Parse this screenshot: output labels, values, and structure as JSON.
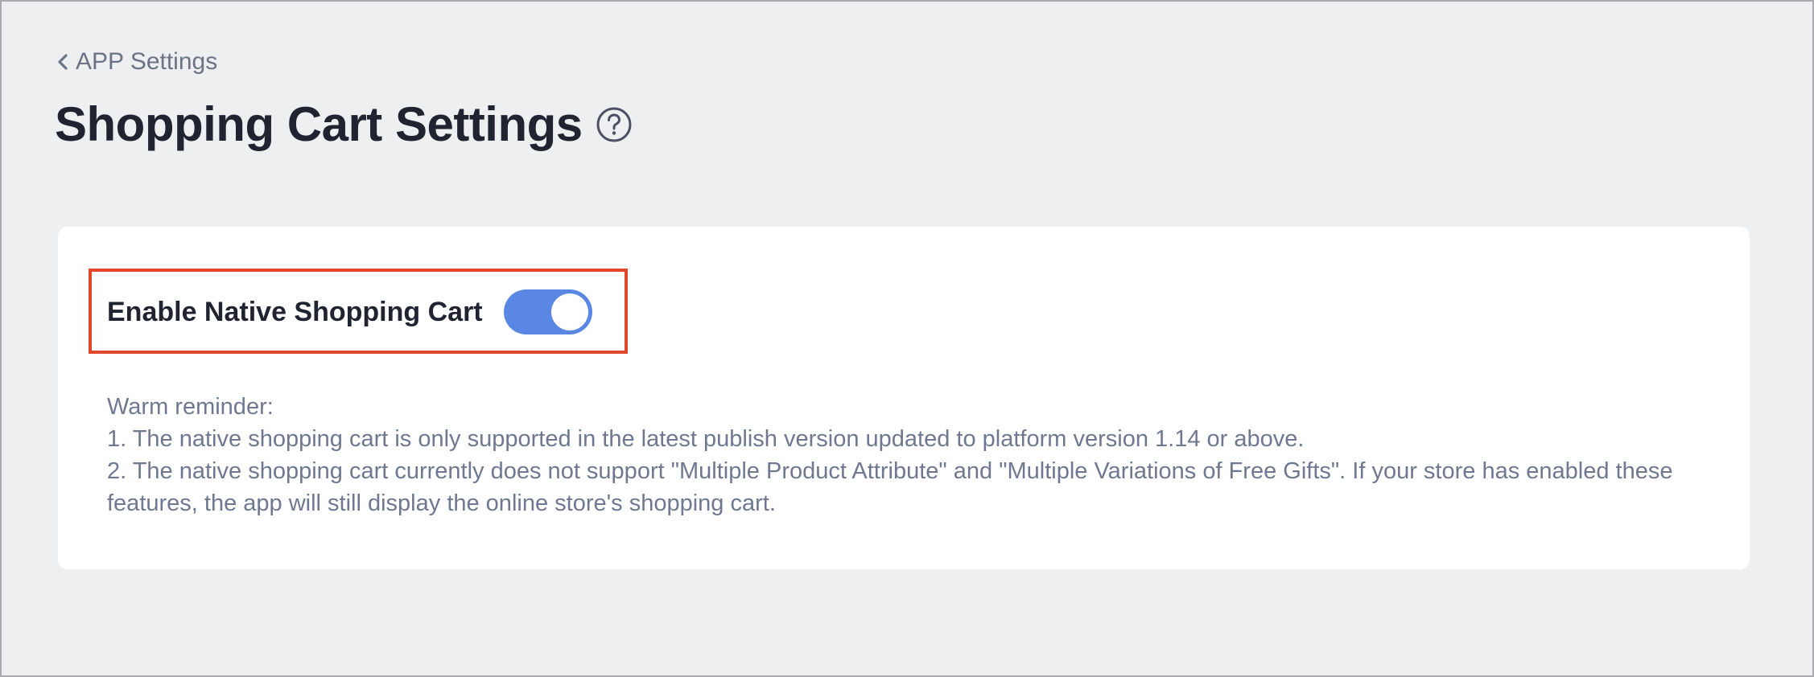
{
  "header": {
    "back_label": "APP Settings",
    "title": "Shopping Cart Settings",
    "help_icon": "question-circle-icon"
  },
  "settings": {
    "native_cart_toggle": {
      "label": "Enable Native Shopping Cart",
      "enabled": true
    },
    "reminder": {
      "heading": "Warm reminder:",
      "items": [
        "1. The native shopping cart is only supported in the latest publish version updated to platform version 1.14 or above.",
        "2. The native shopping cart currently does not support \"Multiple Product Attribute\" and \"Multiple Variations of Free Gifts\". If your store has enabled these features, the app will still display the online store's shopping cart."
      ]
    }
  },
  "colors": {
    "toggle_on": "#5b87e4",
    "highlight": "#e0472d",
    "muted_text": "#6f7890",
    "page_background": "#eeeff1"
  }
}
